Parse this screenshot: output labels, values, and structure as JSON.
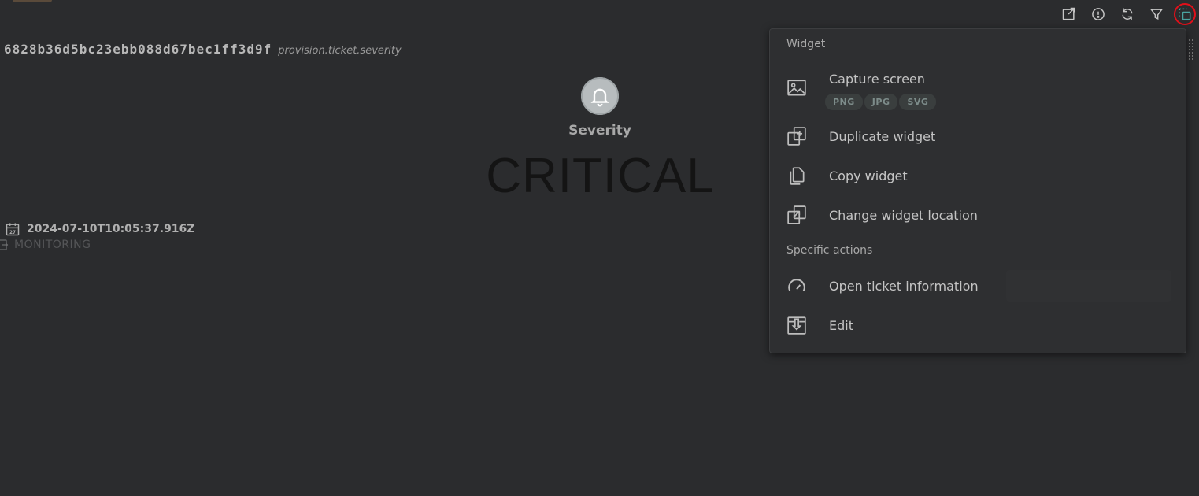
{
  "ticket": {
    "id": "6828b36d5bc23ebb088d67bec1ff3d9f",
    "field": "provision.ticket.severity"
  },
  "severity": {
    "label": "Severity",
    "value": "CRITICAL",
    "icon": "bell-icon"
  },
  "meta": {
    "date": "2024-07-10T10:05:37.916Z",
    "status": "MONITORING"
  },
  "toolbar": {
    "icons": [
      "export-icon",
      "info-icon",
      "refresh-icon",
      "filter-icon",
      "widget-menu-icon"
    ]
  },
  "menu": {
    "widget_section": "Widget",
    "capture_label": "Capture screen",
    "formats": [
      "PNG",
      "JPG",
      "SVG"
    ],
    "duplicate_label": "Duplicate widget",
    "copy_label": "Copy widget",
    "change_location_label": "Change widget location",
    "specific_section": "Specific actions",
    "open_ticket_label": "Open ticket information",
    "edit_label": "Edit"
  },
  "colors": {
    "background": "#2b2c2e",
    "menu_bg": "#2e2f31",
    "highlight_ring": "#e0101a",
    "accent": "#4aa3a0"
  }
}
